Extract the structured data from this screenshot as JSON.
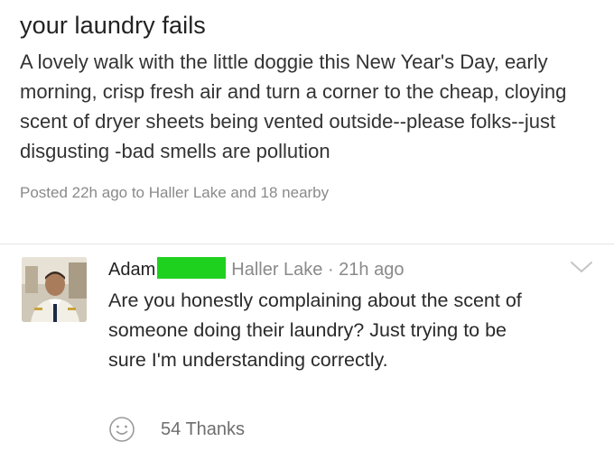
{
  "post": {
    "title": "your laundry fails",
    "body": "A lovely walk with the little doggie this New Year's Day, early morning, crisp fresh air and turn a corner to the cheap, cloying scent of dryer sheets being vented outside--please folks--just disgusting -bad smells are pollution",
    "meta": "Posted 22h ago to Haller Lake and 18 nearby"
  },
  "comment": {
    "author": "Adam",
    "location_time": "Haller Lake · 21h ago",
    "text": "Are you honestly complaining about the scent of someone doing their laundry? Just trying to be sure I'm understanding correctly.",
    "thanks": "54 Thanks",
    "redaction_color": "#1fd11f"
  },
  "icons": {
    "thanks": "smile-icon",
    "menu": "chevron-down-icon"
  },
  "colors": {
    "text_primary": "#222222",
    "text_secondary": "#8a8a8a",
    "divider": "#e4e4e4"
  }
}
